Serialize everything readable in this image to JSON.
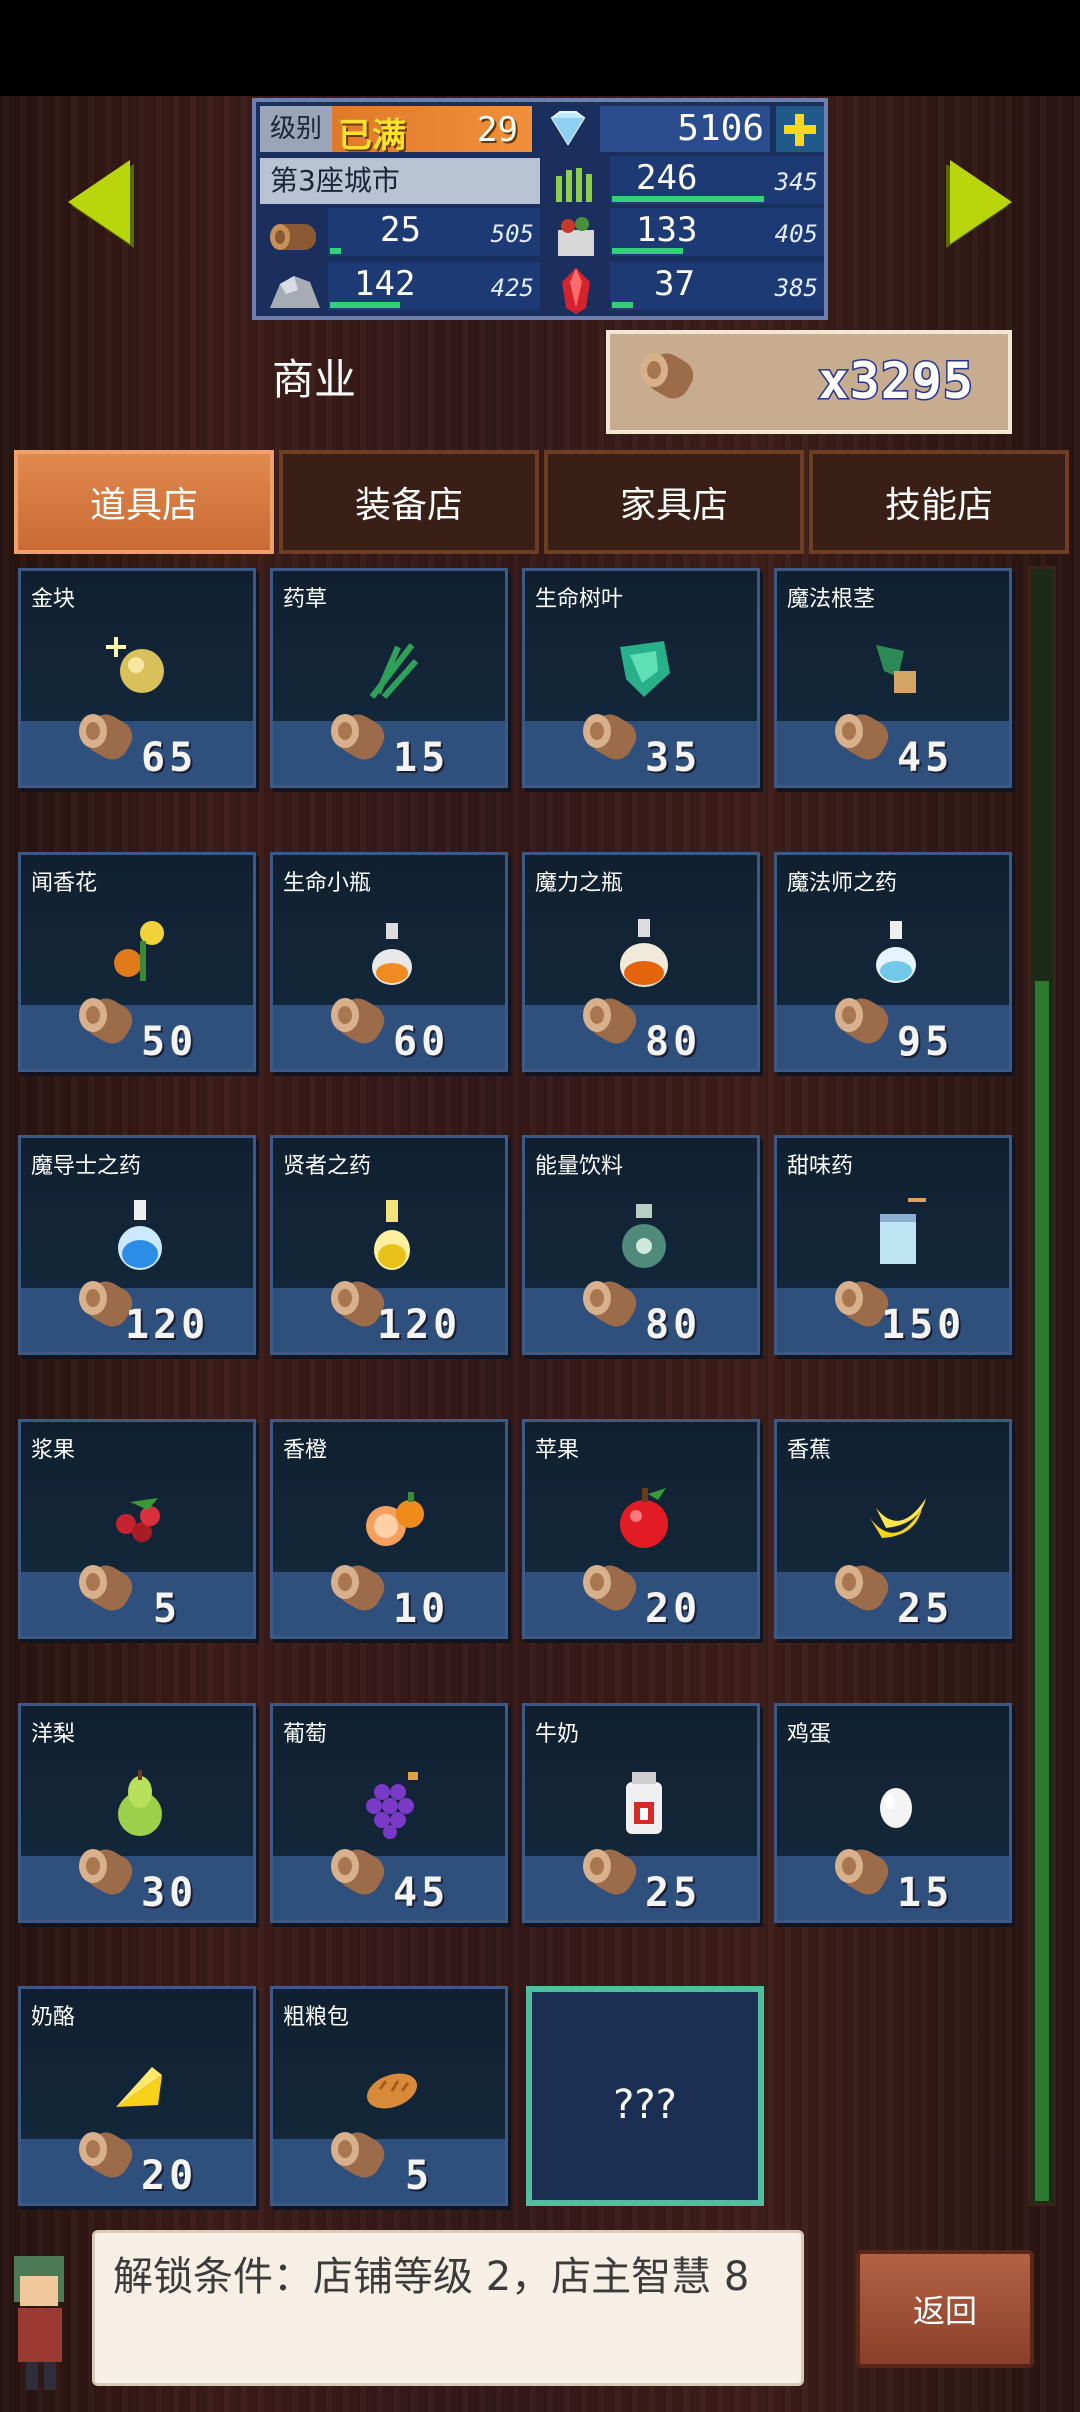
{
  "hud": {
    "level_label": "级别",
    "level_max_label": "已满",
    "level_value": "29",
    "gems": "5106",
    "city_name": "第3座城市",
    "resources": [
      {
        "icon": "wood-log-icon",
        "value": "25",
        "max": "505",
        "fill": 0.05
      },
      {
        "icon": "stone-ore-icon",
        "value": "142",
        "max": "425",
        "fill": 0.33
      },
      {
        "icon": "grass-crop-icon",
        "value": "246",
        "max": "345",
        "fill": 0.71
      },
      {
        "icon": "produce-basket-icon",
        "value": "133",
        "max": "405",
        "fill": 0.33
      },
      {
        "icon": "red-crystal-icon",
        "value": "37",
        "max": "385",
        "fill": 0.1
      }
    ]
  },
  "page": {
    "title": "商业",
    "coins": "x3295"
  },
  "tabs": [
    {
      "label": "道具店",
      "active": true
    },
    {
      "label": "装备店",
      "active": false
    },
    {
      "label": "家具店",
      "active": false
    },
    {
      "label": "技能店",
      "active": false
    }
  ],
  "items": [
    {
      "name": "金块",
      "price": "65",
      "icon": "gold-nugget-icon"
    },
    {
      "name": "药草",
      "price": "15",
      "icon": "herb-icon"
    },
    {
      "name": "生命树叶",
      "price": "35",
      "icon": "life-leaf-icon"
    },
    {
      "name": "魔法根茎",
      "price": "45",
      "icon": "magic-root-icon"
    },
    {
      "name": "闻香花",
      "price": "50",
      "icon": "fragrant-flower-icon"
    },
    {
      "name": "生命小瓶",
      "price": "60",
      "icon": "small-potion-icon"
    },
    {
      "name": "魔力之瓶",
      "price": "80",
      "icon": "mana-potion-icon"
    },
    {
      "name": "魔法师之药",
      "price": "95",
      "icon": "mage-potion-icon"
    },
    {
      "name": "魔导士之药",
      "price": "120",
      "icon": "blue-potion-icon"
    },
    {
      "name": "贤者之药",
      "price": "120",
      "icon": "yellow-potion-icon"
    },
    {
      "name": "能量饮料",
      "price": "80",
      "icon": "energy-drink-icon"
    },
    {
      "name": "甜味药",
      "price": "150",
      "icon": "sweet-medicine-icon"
    },
    {
      "name": "浆果",
      "price": "5",
      "icon": "berry-icon"
    },
    {
      "name": "香橙",
      "price": "10",
      "icon": "orange-icon"
    },
    {
      "name": "苹果",
      "price": "20",
      "icon": "apple-icon"
    },
    {
      "name": "香蕉",
      "price": "25",
      "icon": "banana-icon"
    },
    {
      "name": "洋梨",
      "price": "30",
      "icon": "pear-icon"
    },
    {
      "name": "葡萄",
      "price": "45",
      "icon": "grape-icon"
    },
    {
      "name": "牛奶",
      "price": "25",
      "icon": "milk-icon"
    },
    {
      "name": "鸡蛋",
      "price": "15",
      "icon": "egg-icon"
    },
    {
      "name": "奶酪",
      "price": "20",
      "icon": "cheese-icon"
    },
    {
      "name": "粗粮包",
      "price": "5",
      "icon": "bread-icon"
    }
  ],
  "locked_item": {
    "label": "???"
  },
  "hint": "解锁条件：店铺等级 2，店主智慧 8",
  "back_label": "返回"
}
